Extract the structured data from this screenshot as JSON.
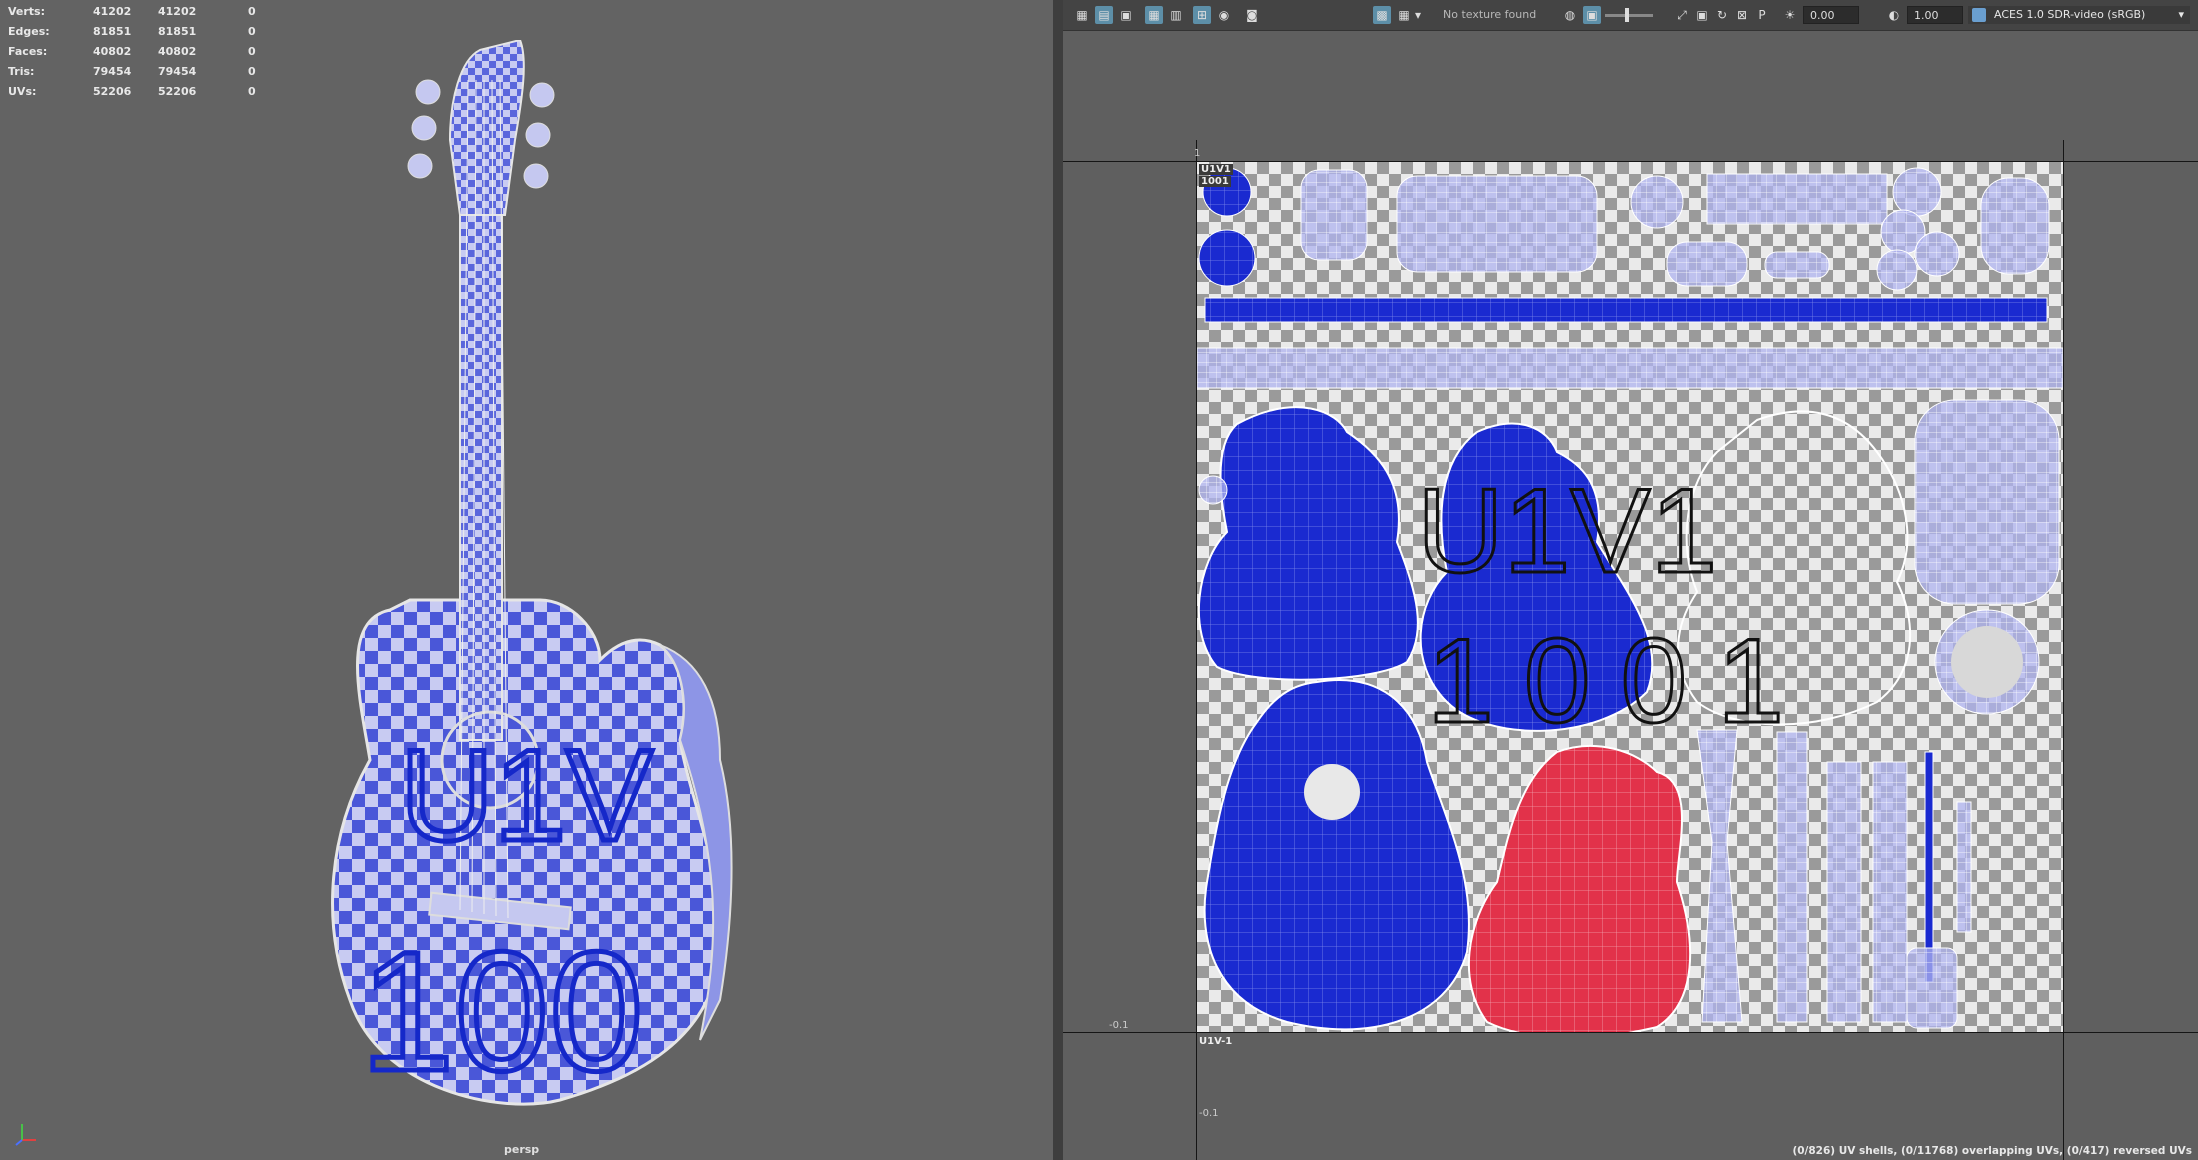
{
  "viewport": {
    "camera": "persp",
    "stats": [
      {
        "label": "Verts:",
        "a": "41202",
        "b": "41202",
        "c": "0"
      },
      {
        "label": "Edges:",
        "a": "81851",
        "b": "81851",
        "c": "0"
      },
      {
        "label": "Faces:",
        "a": "40802",
        "b": "40802",
        "c": "0"
      },
      {
        "label": "Tris:",
        "a": "79454",
        "b": "79454",
        "c": "0"
      },
      {
        "label": "UVs:",
        "a": "52206",
        "b": "52206",
        "c": "0"
      }
    ],
    "body_text_top": "U1V",
    "body_text_bottom": "100"
  },
  "uv_editor": {
    "toolbar": {
      "texture_status": "No texture found",
      "value_1": "0.00",
      "value_2": "1.00",
      "color_space": "ACES 1.0 SDR-video (sRGB)"
    },
    "tiles": {
      "main_label_line1": "U1V1",
      "main_label_line2": "1001",
      "below_label": "U1V-1",
      "big_text_top": "U1V1",
      "big_text_bottom": "1001",
      "tick_top": "1",
      "tick_left": "-0.1",
      "tick_bottom": "-0.1"
    },
    "status": "(0/826) UV shells, (0/11768) overlapping UVs, (0/417) reversed UVs"
  },
  "colors": {
    "uv_blue": "#1e2fd6",
    "uv_red": "#e0314a",
    "uv_light": "#b8bcf0"
  }
}
